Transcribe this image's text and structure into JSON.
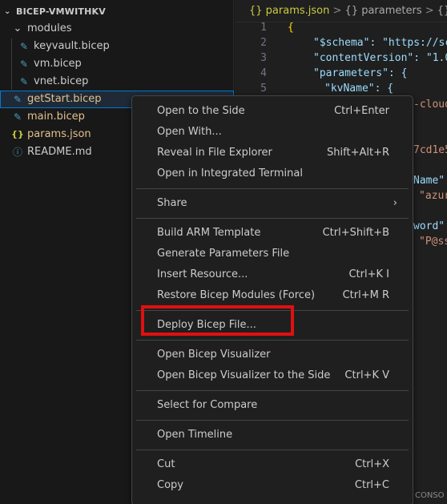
{
  "explorer": {
    "title": "BICEP-VMWITHKV",
    "items": [
      {
        "label": "modules",
        "icon": "chevron-down-icon",
        "indent": 1
      },
      {
        "label": "keyvault.bicep",
        "icon": "bicep-file-icon",
        "indent": 2
      },
      {
        "label": "vm.bicep",
        "icon": "bicep-file-icon",
        "indent": 2
      },
      {
        "label": "vnet.bicep",
        "icon": "bicep-file-icon",
        "indent": 2
      },
      {
        "label": "getStart.bicep",
        "icon": "bicep-file-icon",
        "indent": 1,
        "selected": true
      },
      {
        "label": "main.bicep",
        "icon": "bicep-file-icon",
        "indent": 1
      },
      {
        "label": "params.json",
        "icon": "json-file-icon",
        "indent": 1
      },
      {
        "label": "README.md",
        "icon": "info-icon",
        "indent": 1
      }
    ]
  },
  "breadcrumb": [
    "{} params.json",
    "{} parameters",
    "{} kvNa"
  ],
  "editor": {
    "line_numbers": [
      "1",
      "2",
      "3",
      "4",
      "5"
    ],
    "lines": [
      "{",
      "\"$schema\": \"https://sc",
      "\"contentVersion\": \"1.0",
      "\"parameters\": {",
      "\"kvName\": {"
    ],
    "partials": [
      "-cloud",
      "7cd1e5",
      "Name\":",
      "\"azur",
      "word\"",
      "\"P@ss"
    ]
  },
  "status": {
    "console": "CONSO"
  },
  "context_menu": {
    "groups": [
      [
        {
          "label": "Open to the Side",
          "shortcut": "Ctrl+Enter"
        },
        {
          "label": "Open With...",
          "shortcut": ""
        },
        {
          "label": "Reveal in File Explorer",
          "shortcut": "Shift+Alt+R"
        },
        {
          "label": "Open in Integrated Terminal",
          "shortcut": ""
        }
      ],
      [
        {
          "label": "Share",
          "shortcut": "",
          "submenu": true
        }
      ],
      [
        {
          "label": "Build ARM Template",
          "shortcut": "Ctrl+Shift+B"
        },
        {
          "label": "Generate Parameters File",
          "shortcut": ""
        },
        {
          "label": "Insert Resource...",
          "shortcut": "Ctrl+K I"
        },
        {
          "label": "Restore Bicep Modules (Force)",
          "shortcut": "Ctrl+M R"
        }
      ],
      [
        {
          "label": "Deploy Bicep File...",
          "shortcut": ""
        }
      ],
      [
        {
          "label": "Open Bicep Visualizer",
          "shortcut": ""
        },
        {
          "label": "Open Bicep Visualizer to the Side",
          "shortcut": "Ctrl+K V"
        }
      ],
      [
        {
          "label": "Select for Compare",
          "shortcut": ""
        }
      ],
      [
        {
          "label": "Open Timeline",
          "shortcut": ""
        }
      ],
      [
        {
          "label": "Cut",
          "shortcut": "Ctrl+X"
        },
        {
          "label": "Copy",
          "shortcut": "Ctrl+C"
        }
      ]
    ]
  },
  "colors": {
    "accent": "#0078d4",
    "highlight_box": "#e01010",
    "bicep_icon": "#519aba",
    "json_icon": "#cbcb41",
    "modified_file": "#e2c08d"
  }
}
